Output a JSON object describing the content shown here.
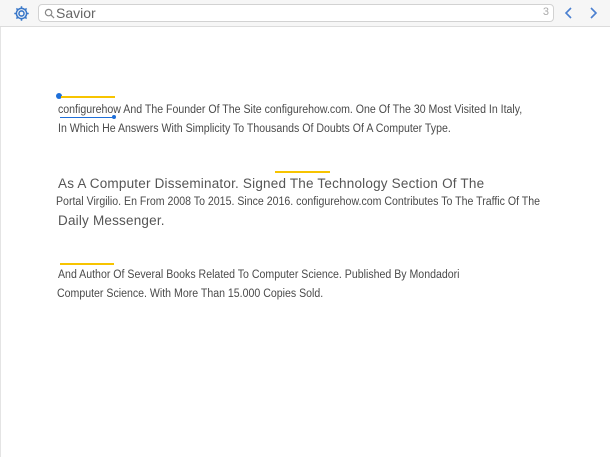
{
  "toolbar": {
    "settings_icon": "gear-icon",
    "search": {
      "value": "Savior",
      "placeholder": "",
      "icon": "search-icon",
      "match_count": "3"
    },
    "prev_icon": "chevron-left-icon",
    "next_icon": "chevron-right-icon",
    "accent_color": "#1e6fd9"
  },
  "content": {
    "highlight_color": "#f7c400",
    "paragraphs": [
      {
        "lines": [
          "configurehow And The Founder Of The Site configurehow.com. One Of The 30 Most Visited In Italy,",
          "In Which He Answers With Simplicity To Thousands Of Doubts Of A Computer Type."
        ]
      },
      {
        "lines": [
          "As A Computer Disseminator.  Signed The Technology Section Of The",
          "Portal Virgilio. En From 2008 To 2015. Since 2016. configurehow.com Contributes To The Traffic Of The",
          "Daily Messenger."
        ]
      },
      {
        "lines": [
          "And Author Of Several Books Related To Computer Science. Published By Mondadori",
          "Computer Science. With More Than 15.000 Copies Sold."
        ]
      }
    ]
  }
}
